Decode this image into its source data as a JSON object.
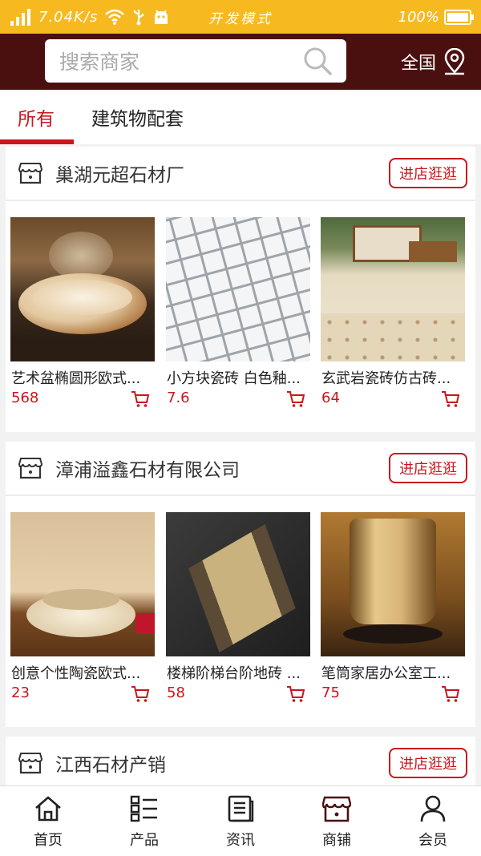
{
  "status_bar": {
    "speed": "7.04K/s",
    "mode": "开发模式",
    "battery": "100%"
  },
  "search": {
    "placeholder": "搜索商家"
  },
  "region": {
    "label": "全国"
  },
  "tabs": [
    {
      "label": "所有",
      "active": true
    },
    {
      "label": "建筑物配套",
      "active": false
    }
  ],
  "shops": [
    {
      "name": "巢湖元超石材厂",
      "visit_label": "进店逛逛",
      "products": [
        {
          "title": "艺术盆椭圆形欧式...",
          "price": "568"
        },
        {
          "title": "小方块瓷砖 白色釉...",
          "price": "7.6"
        },
        {
          "title": "玄武岩瓷砖仿古砖...",
          "price": "64"
        }
      ]
    },
    {
      "name": "漳浦溢鑫石材有限公司",
      "visit_label": "进店逛逛",
      "products": [
        {
          "title": "创意个性陶瓷欧式...",
          "price": "23"
        },
        {
          "title": "楼梯阶梯台阶地砖 ...",
          "price": "58"
        },
        {
          "title": "笔筒家居办公室工...",
          "price": "75"
        }
      ]
    },
    {
      "name": "江西石材产销",
      "visit_label": "进店逛逛",
      "products": []
    }
  ],
  "bottom_nav": [
    {
      "label": "首页",
      "icon": "home-icon"
    },
    {
      "label": "产品",
      "icon": "product-list-icon"
    },
    {
      "label": "资讯",
      "icon": "news-icon"
    },
    {
      "label": "商铺",
      "icon": "shop-icon"
    },
    {
      "label": "会员",
      "icon": "member-icon"
    }
  ],
  "colors": {
    "status_bar": "#f6b91f",
    "header": "#4a1010",
    "accent": "#c8161d"
  }
}
